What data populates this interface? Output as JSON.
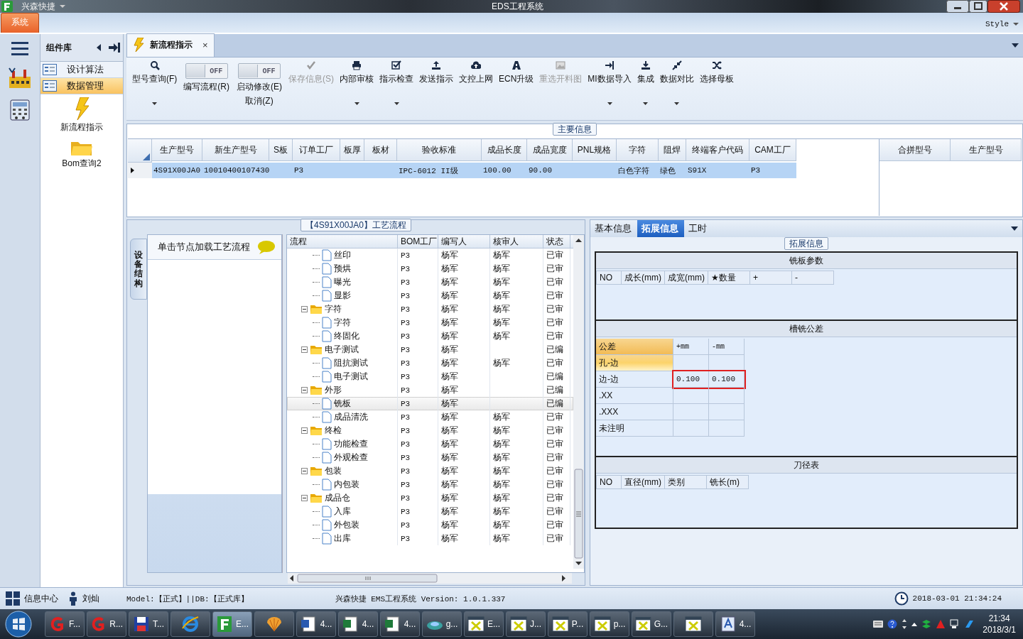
{
  "title_bar": {
    "app_name": "兴森快捷",
    "title": "EDS工程系统"
  },
  "ribbon": {
    "tabs": [
      {
        "label": "系统",
        "selected": true
      }
    ],
    "style_label": "Style"
  },
  "sidebar": {
    "title": "组件库",
    "items": [
      {
        "label": "设计算法",
        "selected": false
      },
      {
        "label": "数据管理",
        "selected": true
      }
    ],
    "tiles": [
      {
        "label": "新流程指示",
        "kind": "lightning"
      },
      {
        "label": "Bom查询2",
        "kind": "folder"
      }
    ]
  },
  "doc_tabs": [
    {
      "label": "新流程指示",
      "selected": true,
      "close_label": "×"
    }
  ],
  "toolbar": [
    {
      "kind": "button",
      "label": "型号查询(F)",
      "disabled": false,
      "dropdown": true
    },
    {
      "kind": "toggle",
      "label": "编写流程(R)",
      "on": false,
      "state_text": "OFF"
    },
    {
      "kind": "toggle",
      "label": "启动修改(E)",
      "sublabel": "取消(Z)",
      "on": false,
      "state_text": "OFF"
    },
    {
      "kind": "button",
      "label": "保存信息(S)",
      "disabled": true,
      "dropdown": false
    },
    {
      "kind": "button",
      "label": "内部审核",
      "disabled": false,
      "dropdown": true
    },
    {
      "kind": "button",
      "label": "指示检查",
      "disabled": false,
      "dropdown": true
    },
    {
      "kind": "button",
      "label": "发送指示",
      "disabled": false,
      "dropdown": false
    },
    {
      "kind": "button",
      "label": "文控上网",
      "disabled": false,
      "dropdown": false
    },
    {
      "kind": "button",
      "label": "ECN升级",
      "disabled": false,
      "dropdown": false
    },
    {
      "kind": "button",
      "label": "重选开料图",
      "disabled": true,
      "dropdown": false
    },
    {
      "kind": "button",
      "label": "MI数据导入",
      "disabled": false,
      "dropdown": true
    },
    {
      "kind": "button",
      "label": "集成",
      "disabled": false,
      "dropdown": true
    },
    {
      "kind": "button",
      "label": "数据对比",
      "disabled": false,
      "dropdown": true
    },
    {
      "kind": "button",
      "label": "选择母板",
      "disabled": false,
      "dropdown": false
    }
  ],
  "main_info": {
    "title": "主要信息",
    "columns": [
      "生产型号",
      "新生产型号",
      "S板",
      "订单工厂",
      "板厚",
      "板材",
      "验收标准",
      "成品长度",
      "成品宽度",
      "PNL规格",
      "字符",
      "阻焊",
      "终端客户代码",
      "CAM工厂"
    ],
    "rows": [
      {
        "selected": true,
        "cells": [
          "4S91X00JA0",
          "10010400107430",
          null,
          "P3",
          null,
          null,
          "IPC-6012 II级",
          "100.00",
          "90.00",
          null,
          "白色字符",
          "绿色",
          "S91X",
          "P3"
        ]
      }
    ],
    "side_columns": [
      "合拼型号",
      "生产型号"
    ]
  },
  "process": {
    "title": "【4S91X00JA0】工艺流程",
    "side_tab": "设备结构",
    "hint": "单击节点加载工艺流程",
    "columns": [
      "流程",
      "BOM工厂",
      "编写人",
      "核审人",
      "状态"
    ],
    "tree": [
      {
        "children": [
          {
            "kind": "leaf",
            "label": "丝印",
            "selected": false,
            "cells": [
              "P3",
              "杨军",
              "杨军",
              "已审"
            ]
          },
          {
            "kind": "leaf",
            "label": "预烘",
            "selected": false,
            "cells": [
              "P3",
              "杨军",
              "杨军",
              "已审"
            ]
          },
          {
            "kind": "leaf",
            "label": "曝光",
            "selected": false,
            "cells": [
              "P3",
              "杨军",
              "杨军",
              "已审"
            ]
          },
          {
            "kind": "leaf",
            "label": "显影",
            "selected": false,
            "cells": [
              "P3",
              "杨军",
              "杨军",
              "已审"
            ]
          }
        ]
      },
      {
        "kind": "folder",
        "label": "字符",
        "expanded": true,
        "selected": false,
        "cells": [
          "P3",
          "杨军",
          "杨军",
          "已审"
        ],
        "children": [
          {
            "kind": "leaf",
            "label": "字符",
            "selected": false,
            "cells": [
              "P3",
              "杨军",
              "杨军",
              "已审"
            ]
          },
          {
            "kind": "leaf",
            "label": "终固化",
            "selected": false,
            "cells": [
              "P3",
              "杨军",
              "杨军",
              "已审"
            ]
          }
        ]
      },
      {
        "kind": "folder",
        "label": "电子测试",
        "expanded": true,
        "selected": false,
        "cells": [
          "P3",
          "杨军",
          null,
          "已编"
        ],
        "children": [
          {
            "kind": "leaf",
            "label": "阻抗测试",
            "selected": false,
            "cells": [
              "P3",
              "杨军",
              "杨军",
              "已审"
            ]
          },
          {
            "kind": "leaf",
            "label": "电子测试",
            "selected": false,
            "cells": [
              "P3",
              "杨军",
              null,
              "已编"
            ]
          }
        ]
      },
      {
        "kind": "folder",
        "label": "外形",
        "expanded": true,
        "selected": false,
        "cells": [
          "P3",
          "杨军",
          null,
          "已编"
        ],
        "children": [
          {
            "kind": "leaf",
            "label": "铣板",
            "selected": true,
            "cells": [
              "P3",
              "杨军",
              null,
              "已编"
            ]
          },
          {
            "kind": "leaf",
            "label": "成品清洗",
            "selected": false,
            "cells": [
              "P3",
              "杨军",
              "杨军",
              "已审"
            ]
          }
        ]
      },
      {
        "kind": "folder",
        "label": "终检",
        "expanded": true,
        "selected": false,
        "cells": [
          "P3",
          "杨军",
          "杨军",
          "已审"
        ],
        "children": [
          {
            "kind": "leaf",
            "label": "功能检查",
            "selected": false,
            "cells": [
              "P3",
              "杨军",
              "杨军",
              "已审"
            ]
          },
          {
            "kind": "leaf",
            "label": "外观检查",
            "selected": false,
            "cells": [
              "P3",
              "杨军",
              "杨军",
              "已审"
            ]
          }
        ]
      },
      {
        "kind": "folder",
        "label": "包装",
        "expanded": true,
        "selected": false,
        "cells": [
          "P3",
          "杨军",
          "杨军",
          "已审"
        ],
        "children": [
          {
            "kind": "leaf",
            "label": "内包装",
            "selected": false,
            "cells": [
              "P3",
              "杨军",
              "杨军",
              "已审"
            ]
          }
        ]
      },
      {
        "kind": "folder",
        "label": "成品仓",
        "expanded": true,
        "selected": false,
        "cells": [
          "P3",
          "杨军",
          "杨军",
          "已审"
        ],
        "children": [
          {
            "kind": "leaf",
            "label": "入库",
            "selected": false,
            "cells": [
              "P3",
              "杨军",
              "杨军",
              "已审"
            ]
          },
          {
            "kind": "leaf",
            "label": "外包装",
            "selected": false,
            "cells": [
              "P3",
              "杨军",
              "杨军",
              "已审"
            ]
          },
          {
            "kind": "leaf",
            "label": "出库",
            "selected": false,
            "cells": [
              "P3",
              "杨军",
              "杨军",
              "已审"
            ]
          }
        ]
      }
    ]
  },
  "detail": {
    "tabs": [
      {
        "label": "基本信息",
        "selected": false
      },
      {
        "label": "拓展信息",
        "selected": true
      },
      {
        "label": "工时",
        "selected": false
      }
    ],
    "group_title": "拓展信息",
    "milling": {
      "title": "铣板参数",
      "columns": [
        "NO",
        "成长(mm)",
        "成宽(mm)",
        "★数量",
        "+",
        "-"
      ]
    },
    "tolerance": {
      "title": "槽铣公差",
      "header": [
        "公差",
        "+mm",
        "-mm"
      ],
      "rows": [
        {
          "label": "孔-边",
          "selected": true,
          "annotated": false
        },
        {
          "label": "边-边",
          "selected": false,
          "annotated": true,
          "values": [
            "0.100",
            "0.100"
          ]
        },
        {
          "label": ".XX",
          "selected": false,
          "annotated": false
        },
        {
          "label": ".XXX",
          "selected": false,
          "annotated": false
        },
        {
          "label": "未注明",
          "selected": false,
          "annotated": false
        }
      ]
    },
    "tools": {
      "title": "刀径表",
      "columns": [
        "NO",
        "直径(mm)",
        "类别",
        "铣长(m)"
      ]
    }
  },
  "status_bar": {
    "info_center": "信息中心",
    "user": "刘灿",
    "model": "Model:【正式】||DB:【正式库】",
    "version": "兴森快捷 EMS工程系统 Version: 1.0.1.337",
    "datetime": "2018-03-01 21:34:24"
  },
  "taskbar": {
    "items": [
      {
        "label": "F...",
        "active": false
      },
      {
        "label": "R...",
        "active": false
      },
      {
        "label": "T...",
        "active": false
      },
      {
        "active": false
      },
      {
        "label": "E...",
        "active": true
      },
      {
        "active": false
      },
      {
        "label": "4...",
        "active": false
      },
      {
        "label": "4...",
        "active": false
      },
      {
        "label": "4...",
        "active": false
      },
      {
        "label": "g...",
        "active": false
      },
      {
        "label": "E...",
        "active": false
      },
      {
        "label": "J...",
        "active": false
      },
      {
        "label": "P...",
        "active": false
      },
      {
        "label": "p...",
        "active": false
      },
      {
        "label": "G...",
        "active": false
      },
      {
        "active": false
      },
      {
        "label": "4...",
        "active": false
      }
    ],
    "time": "21:34",
    "date": "2018/3/1"
  }
}
